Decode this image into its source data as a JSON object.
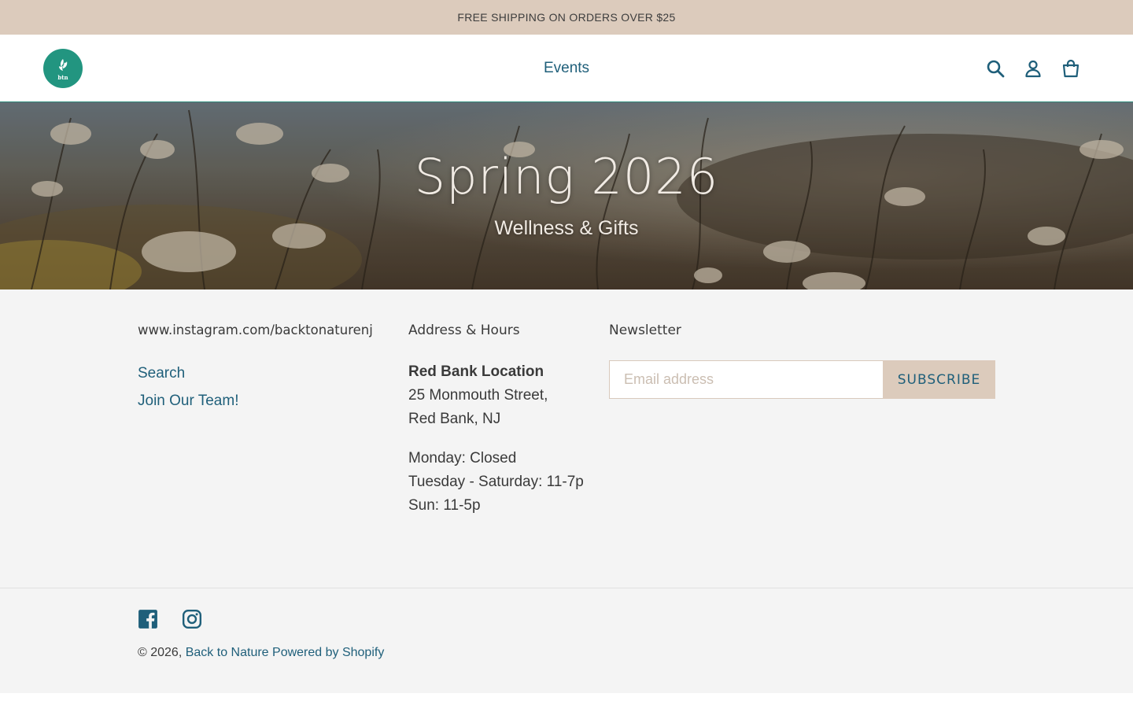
{
  "announcement": {
    "text": "FREE SHIPPING ON ORDERS OVER $25"
  },
  "header": {
    "logo_text": "btn",
    "nav": [
      {
        "label": "Events"
      }
    ],
    "icons": [
      "search-icon",
      "account-icon",
      "cart-icon"
    ]
  },
  "hero": {
    "title": "Spring 2026",
    "subtitle": "Wellness & Gifts"
  },
  "footer": {
    "col1": {
      "heading": "www.instagram.com/backtonaturenj",
      "links": [
        "Search",
        "Join Our Team!"
      ]
    },
    "col2": {
      "heading": "Address & Hours",
      "location_name": "Red Bank Location",
      "address_line1": "25 Monmouth Street,",
      "address_line2": "Red Bank, NJ",
      "hours": [
        "Monday: Closed",
        "Tuesday - Saturday: 11-7p",
        "Sun: 11-5p"
      ]
    },
    "col3": {
      "heading": "Newsletter",
      "email_placeholder": "Email address",
      "subscribe_label": "SUBSCRIBE"
    },
    "social": [
      "facebook-icon",
      "instagram-icon"
    ],
    "copyright_prefix": "© 2026,",
    "store_name": "Back to Nature",
    "powered_by": "Powered by Shopify"
  },
  "colors": {
    "announcement_bg": "#dccbbc",
    "accent": "#1f5f7a",
    "logo_bg": "#229580",
    "footer_bg": "#f4f4f4"
  }
}
